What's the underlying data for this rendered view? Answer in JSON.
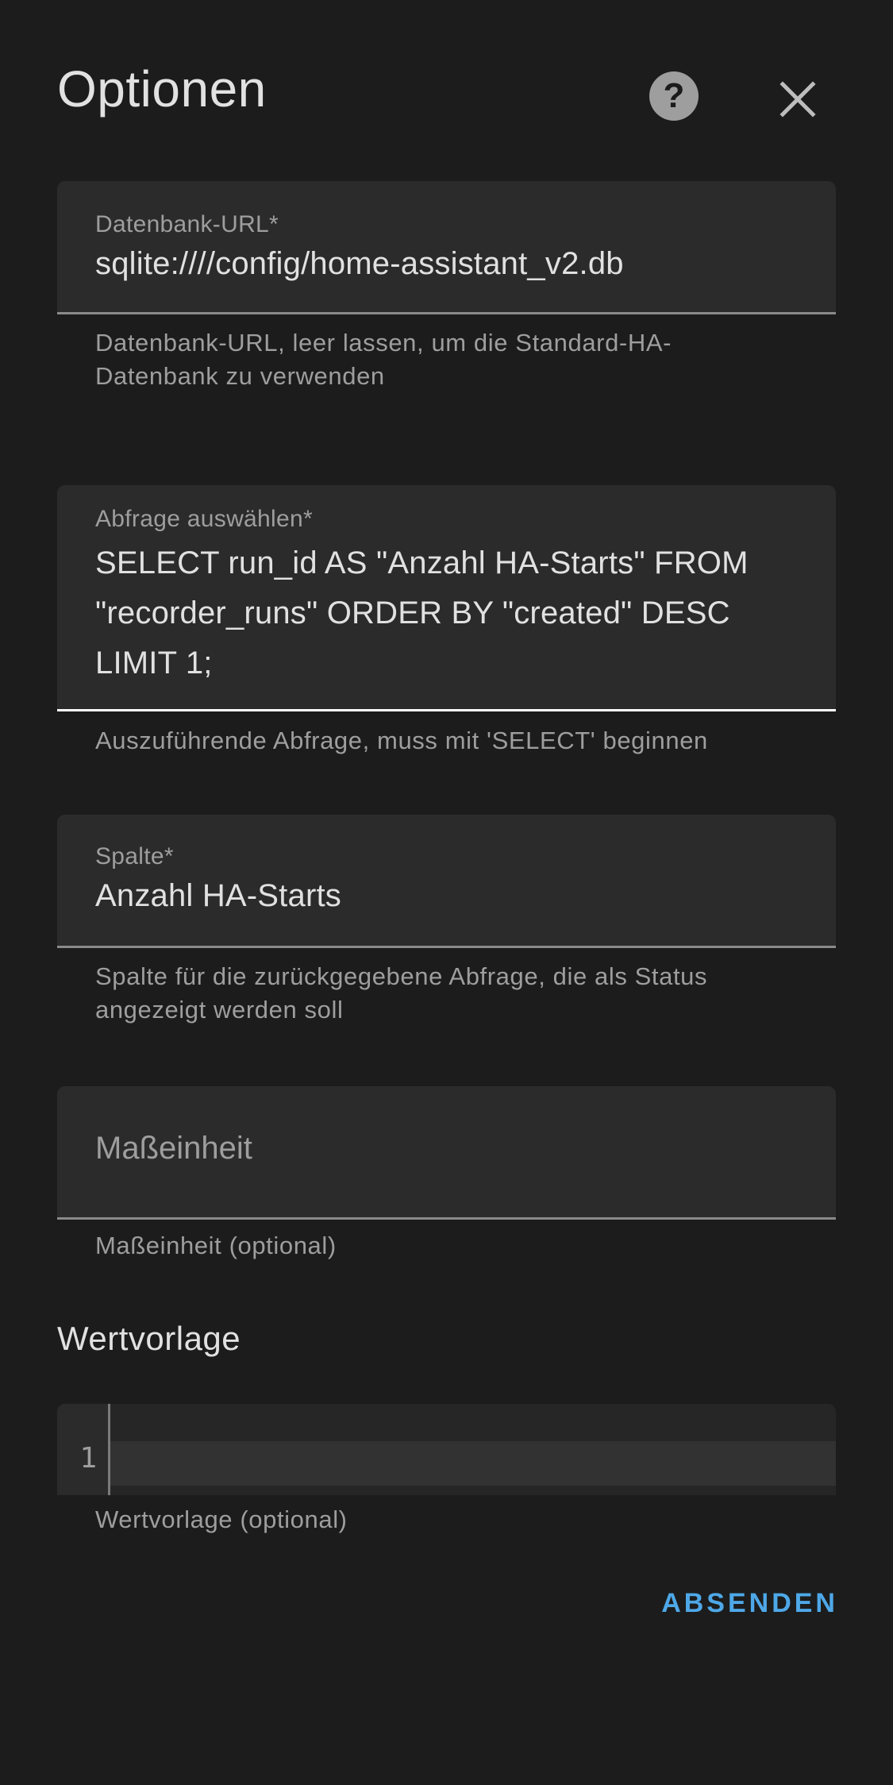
{
  "dialog": {
    "title": "Optionen"
  },
  "fields": {
    "db_url": {
      "label": "Datenbank-URL*",
      "value": "sqlite:////config/home-assistant_v2.db",
      "helper": "Datenbank-URL, leer lassen, um die Standard-HA-Datenbank zu verwenden"
    },
    "query": {
      "label": "Abfrage auswählen*",
      "value_lines": [
        "SELECT run_id AS \"Anzahl HA-Starts\" FROM",
        "\"recorder_runs\" ORDER BY \"created\" DESC",
        "LIMIT 1;"
      ],
      "helper": "Auszuführende Abfrage, muss mit 'SELECT' beginnen"
    },
    "column": {
      "label": "Spalte*",
      "value": "Anzahl HA-Starts",
      "helper": "Spalte für die zurückgegebene Abfrage, die als Status angezeigt werden soll"
    },
    "unit": {
      "placeholder": "Maßeinheit",
      "helper": "Maßeinheit (optional)"
    }
  },
  "template_section": {
    "title": "Wertvorlage",
    "line_number": "1",
    "helper": "Wertvorlage (optional)"
  },
  "actions": {
    "submit_label": "ABSENDEN"
  },
  "colors": {
    "background": "#1c1c1c",
    "field_background": "#2b2b2b",
    "accent": "#4ea8e8"
  },
  "icons": {
    "help": "help-circle-icon",
    "close": "close-icon"
  }
}
